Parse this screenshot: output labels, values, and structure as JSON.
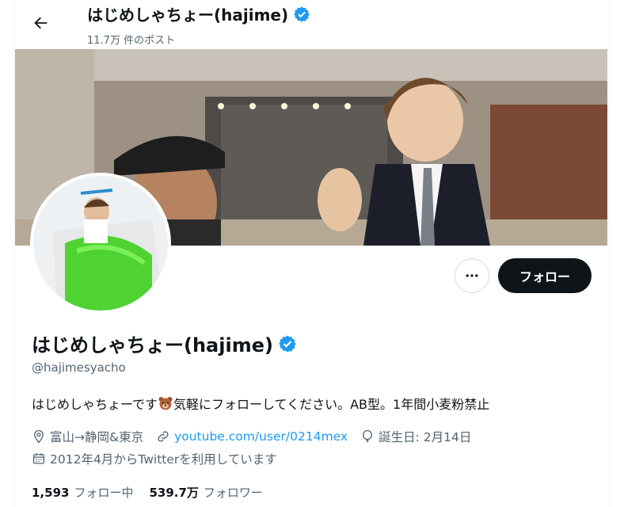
{
  "header": {
    "title": "はじめしゃちょー(hajime)",
    "post_count": "11.7万 件のポスト"
  },
  "profile": {
    "display_name": "はじめしゃちょー(hajime)",
    "handle": "@hajimesyacho",
    "bio_before_emoji": "はじめしゃちょーです",
    "bio_after_emoji": "気軽にフォローしてください。AB型。1年間小麦粉禁止",
    "location": "富山→静岡&東京",
    "website": "youtube.com/user/0214mex",
    "birthday": "誕生日: 2月14日",
    "joined": "2012年4月からTwitterを利用しています"
  },
  "actions": {
    "follow_label": "フォロー"
  },
  "stats": {
    "following_count": "1,593",
    "following_label": "フォロー中",
    "followers_count": "539.7万",
    "followers_label": "フォロワー"
  },
  "icons": [
    "back-arrow-icon",
    "verified-badge-icon",
    "more-icon",
    "location-icon",
    "link-icon",
    "balloon-icon",
    "calendar-icon",
    "bear-emoji-icon"
  ],
  "colors": {
    "accent": "#1d9bf0",
    "primary_button": "#0f1419",
    "secondary_text": "#536471"
  }
}
